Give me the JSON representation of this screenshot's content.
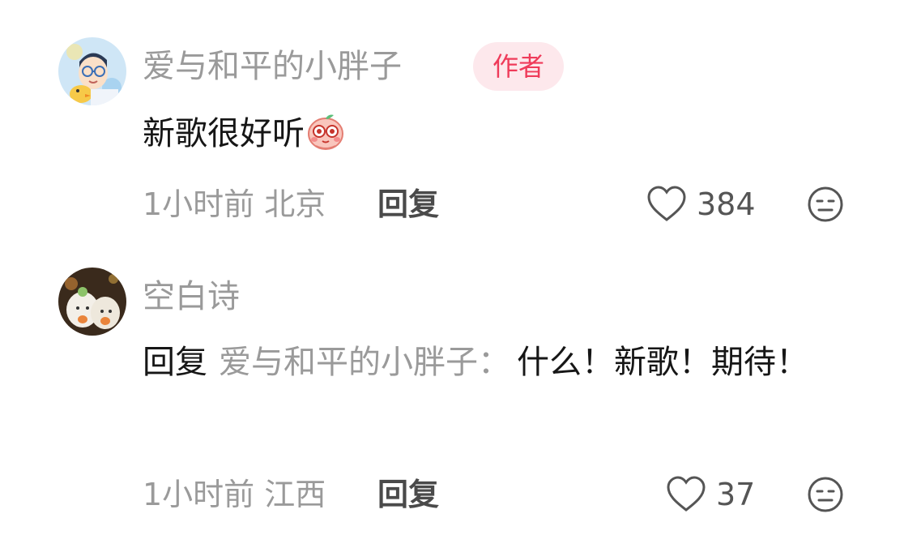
{
  "comments": [
    {
      "username": "爱与和平的小胖子",
      "badge": "作者",
      "text": "新歌很好听",
      "emoji_icon": "blushing-face-emoji",
      "time_location": "1小时前 北京",
      "reply_label": "回复",
      "likes": "384"
    },
    {
      "username": "空白诗",
      "reply_prefix": "回复",
      "reply_target": "爱与和平的小胖子：",
      "text": "什么！新歌！期待！",
      "time_location": "1小时前 江西",
      "reply_label": "回复",
      "likes": "37"
    }
  ],
  "colors": {
    "badge_bg": "#fde8ec",
    "badge_text": "#ef3b5a",
    "muted_text": "#9a9a9a",
    "primary_text": "#161616"
  }
}
